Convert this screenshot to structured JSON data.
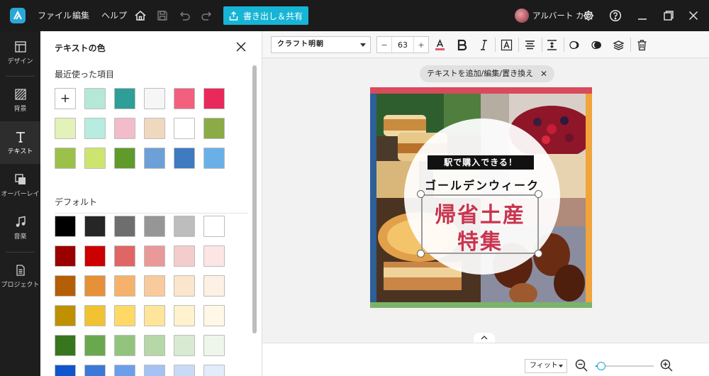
{
  "topbar": {
    "menu": [
      "ファイル",
      "編集",
      "ヘルプ"
    ],
    "share_label": "書き出し＆共有",
    "username": "アルバート カナ",
    "icons": [
      "app-logo-icon",
      "home-icon",
      "save-icon",
      "undo-icon",
      "redo-icon",
      "gear-icon",
      "help-icon",
      "minimize-icon",
      "maximize-icon",
      "close-icon"
    ]
  },
  "rail": {
    "items": [
      {
        "label": "デザイン",
        "icon": "layout-icon"
      },
      {
        "label": "背景",
        "icon": "background-icon"
      },
      {
        "label": "テキスト",
        "icon": "text-icon",
        "active": true
      },
      {
        "label": "オーバーレイ",
        "icon": "overlay-icon"
      },
      {
        "label": "音楽",
        "icon": "music-icon"
      },
      {
        "label": "プロジェクト",
        "icon": "project-icon"
      }
    ]
  },
  "panel": {
    "title": "テキストの色",
    "recent_label": "最近使った項目",
    "recent_add": "+",
    "recent_colors": [
      "#b6e8d8",
      "#2e9e96",
      "#f6f6f6",
      "#f2607e",
      "#e8295a",
      "#e3f2b8",
      "#b8ece0",
      "#f2bccb",
      "#f0d8bf",
      "#ffffff",
      "#8aab45",
      "#9bc14a",
      "#cde56e",
      "#5f9a2a",
      "#6ea0d8",
      "#3f7bc0",
      "#6ab0e8"
    ],
    "default_label": "デフォルト",
    "default_colors": [
      [
        "#000000",
        "#262626",
        "#6e6e6e",
        "#969696",
        "#bdbdbd",
        "#ffffff"
      ],
      [
        "#9b0000",
        "#cc0000",
        "#e06666",
        "#ea9999",
        "#f4cccc",
        "#fbe5e5"
      ],
      [
        "#b45f06",
        "#e69138",
        "#f6b26b",
        "#f9cb9c",
        "#fce5cd",
        "#fdf0e4"
      ],
      [
        "#bf9000",
        "#f1c232",
        "#ffd966",
        "#ffe599",
        "#fff2cc",
        "#fff8e6"
      ],
      [
        "#38761d",
        "#6aa84f",
        "#93c47d",
        "#b6d7a8",
        "#d9ead3",
        "#eef6eb"
      ],
      [
        "#1155cc",
        "#3c78d8",
        "#6d9eeb",
        "#a4c2f4",
        "#c9daf8",
        "#e3ecfb"
      ]
    ]
  },
  "toolbar": {
    "font_name": "クラフト明朝",
    "font_size": "63",
    "minus": "−",
    "plus": "+",
    "text_color": "#e05a6c"
  },
  "hint": {
    "text": "テキストを追加/編集/置き換え",
    "close": "✕"
  },
  "canvas": {
    "badge": "駅で購入できる！",
    "subtitle": "ゴールデンウィーク",
    "title_line1": "帰省土産",
    "title_line2": "特集",
    "title_color": "#c9344f",
    "bar_colors": {
      "top": "#d84a5c",
      "left": "#2e5f97",
      "right": "#f0a43a",
      "bottom": "#7bb36a"
    }
  },
  "bottombar": {
    "fit_label": "フィット",
    "zoom_level": 0.1
  }
}
